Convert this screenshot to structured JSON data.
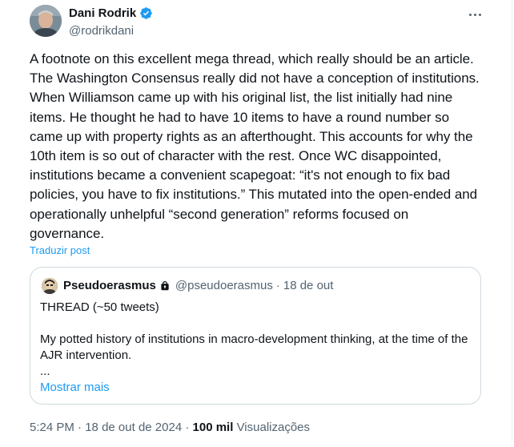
{
  "author": {
    "name": "Dani Rodrik",
    "handle": "@rodrikdani",
    "verified_icon": "verified-badge-icon",
    "avatar_icon": "avatar"
  },
  "menu_icon": "more-options-icon",
  "tweet": {
    "text": "A footnote on this excellent mega thread, which really should be an article. The Washington Consensus really did not have a conception of institutions. When Williamson came up with his original list, the list initially had nine items. He thought he had to have 10 items to have a round number so came up with property rights as an afterthought. This accounts for why the 10th item is so out of character with the rest. Once WC disappointed, institutions became a convenient scapegoat: “it's not enough to fix bad policies, you have to fix institutions.” This mutated into the open-ended and operationally unhelpful “second generation” reforms focused on governance.",
    "translate_label": "Traduzir post"
  },
  "quote": {
    "name": "Pseudoerasmus",
    "lock_icon": "lock-icon",
    "handle": "@pseudoerasmus",
    "separator": "·",
    "time": "18 de out",
    "text": "THREAD (~50 tweets)\n\nMy potted history of institutions in macro-development thinking, at the time of the AJR intervention.\n...",
    "show_more": "Mostrar mais"
  },
  "meta": {
    "time": "5:24 PM",
    "sep1": "·",
    "date": "18 de out de 2024",
    "sep2": "·",
    "views_count": "100 mil",
    "views_label": "Visualizações"
  },
  "colors": {
    "accent": "#1d9bf0",
    "text": "#0f1419",
    "muted": "#536471",
    "border": "#cfd9de"
  }
}
